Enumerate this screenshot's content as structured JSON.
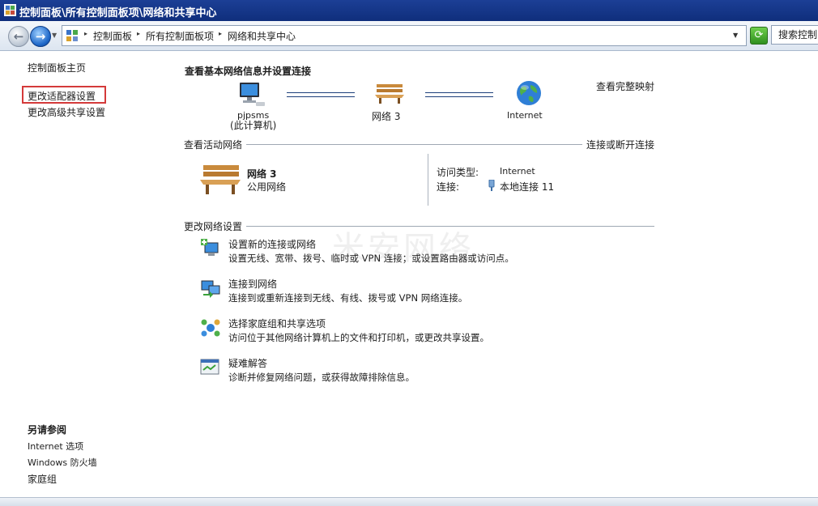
{
  "window": {
    "title": "控制面板\\所有控制面板项\\网络和共享中心"
  },
  "address_bar": {
    "crumbs": [
      "控制面板",
      "所有控制面板项",
      "网络和共享中心"
    ],
    "search_placeholder": "搜索控制"
  },
  "left_pane": {
    "home": "控制面板主页",
    "links": [
      "更改适配器设置",
      "更改高级共享设置"
    ],
    "see_also_title": "另请参阅",
    "see_also": [
      "Internet 选项",
      "Windows 防火墙",
      "家庭组"
    ]
  },
  "main": {
    "title": "查看基本网络信息并设置连接",
    "view_full_map": "查看完整映射",
    "map": {
      "computer_name": "pjpsms",
      "computer_sub": "(此计算机)",
      "network_name": "网络  3",
      "internet": "Internet"
    },
    "active_networks": {
      "header": "查看活动网络",
      "connect_link": "连接或断开连接",
      "network_name": "网络  3",
      "network_type": "公用网络",
      "access_type_label": "访问类型:",
      "access_type_value": "Internet",
      "connection_label": "连接:",
      "connection_value": "本地连接 11"
    },
    "change_settings": {
      "header": "更改网络设置",
      "tasks": [
        {
          "title": "设置新的连接或网络",
          "desc": "设置无线、宽带、拨号、临时或 VPN 连接；或设置路由器或访问点。"
        },
        {
          "title": "连接到网络",
          "desc": "连接到或重新连接到无线、有线、拨号或 VPN 网络连接。"
        },
        {
          "title": "选择家庭组和共享选项",
          "desc": "访问位于其他网络计算机上的文件和打印机，或更改共享设置。"
        },
        {
          "title": "疑难解答",
          "desc": "诊断并修复网络问题，或获得故障排除信息。"
        }
      ]
    }
  },
  "watermark": "米安网络"
}
